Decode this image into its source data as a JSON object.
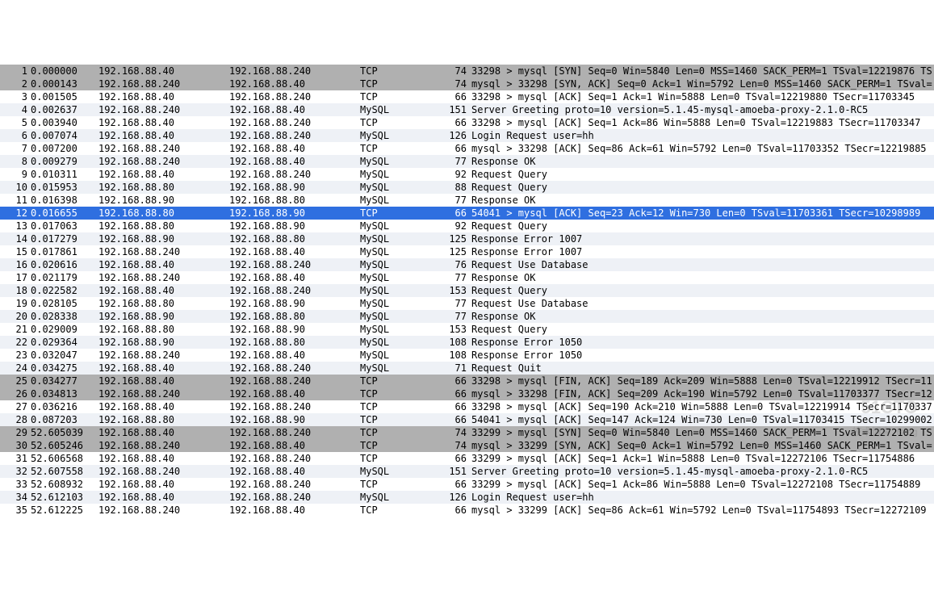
{
  "packets": [
    {
      "no": 1,
      "time": "0.000000",
      "src": "192.168.88.40",
      "dst": "192.168.88.240",
      "proto": "TCP",
      "len": 74,
      "info": "33298 > mysql [SYN] Seq=0 Win=5840 Len=0 MSS=1460 SACK_PERM=1 TSval=12219876 TS",
      "cls": "gray"
    },
    {
      "no": 2,
      "time": "0.000143",
      "src": "192.168.88.240",
      "dst": "192.168.88.40",
      "proto": "TCP",
      "len": 74,
      "info": "mysql > 33298 [SYN, ACK] Seq=0 Ack=1 Win=5792 Len=0 MSS=1460 SACK_PERM=1 TSval=",
      "cls": "gray"
    },
    {
      "no": 3,
      "time": "0.001505",
      "src": "192.168.88.40",
      "dst": "192.168.88.240",
      "proto": "TCP",
      "len": 66,
      "info": "33298 > mysql [ACK] Seq=1 Ack=1 Win=5888 Len=0 TSval=12219880 TSecr=11703345",
      "cls": "even"
    },
    {
      "no": 4,
      "time": "0.002637",
      "src": "192.168.88.240",
      "dst": "192.168.88.40",
      "proto": "MySQL",
      "len": 151,
      "info": "Server Greeting proto=10 version=5.1.45-mysql-amoeba-proxy-2.1.0-RC5",
      "cls": "odd"
    },
    {
      "no": 5,
      "time": "0.003940",
      "src": "192.168.88.40",
      "dst": "192.168.88.240",
      "proto": "TCP",
      "len": 66,
      "info": "33298 > mysql [ACK] Seq=1 Ack=86 Win=5888 Len=0 TSval=12219883 TSecr=11703347",
      "cls": "even"
    },
    {
      "no": 6,
      "time": "0.007074",
      "src": "192.168.88.40",
      "dst": "192.168.88.240",
      "proto": "MySQL",
      "len": 126,
      "info": "Login Request user=hh",
      "cls": "odd"
    },
    {
      "no": 7,
      "time": "0.007200",
      "src": "192.168.88.240",
      "dst": "192.168.88.40",
      "proto": "TCP",
      "len": 66,
      "info": "mysql > 33298 [ACK] Seq=86 Ack=61 Win=5792 Len=0 TSval=11703352 TSecr=12219885",
      "cls": "even"
    },
    {
      "no": 8,
      "time": "0.009279",
      "src": "192.168.88.240",
      "dst": "192.168.88.40",
      "proto": "MySQL",
      "len": 77,
      "info": "Response OK",
      "cls": "odd"
    },
    {
      "no": 9,
      "time": "0.010311",
      "src": "192.168.88.40",
      "dst": "192.168.88.240",
      "proto": "MySQL",
      "len": 92,
      "info": "Request Query",
      "cls": "even"
    },
    {
      "no": 10,
      "time": "0.015953",
      "src": "192.168.88.80",
      "dst": "192.168.88.90",
      "proto": "MySQL",
      "len": 88,
      "info": "Request Query",
      "cls": "odd"
    },
    {
      "no": 11,
      "time": "0.016398",
      "src": "192.168.88.90",
      "dst": "192.168.88.80",
      "proto": "MySQL",
      "len": 77,
      "info": "Response OK",
      "cls": "even"
    },
    {
      "no": 12,
      "time": "0.016655",
      "src": "192.168.88.80",
      "dst": "192.168.88.90",
      "proto": "TCP",
      "len": 66,
      "info": "54041 > mysql [ACK] Seq=23 Ack=12 Win=730 Len=0 TSval=11703361 TSecr=10298989",
      "cls": "sel"
    },
    {
      "no": 13,
      "time": "0.017063",
      "src": "192.168.88.80",
      "dst": "192.168.88.90",
      "proto": "MySQL",
      "len": 92,
      "info": "Request Query",
      "cls": "even"
    },
    {
      "no": 14,
      "time": "0.017279",
      "src": "192.168.88.90",
      "dst": "192.168.88.80",
      "proto": "MySQL",
      "len": 125,
      "info": "Response Error 1007",
      "cls": "odd"
    },
    {
      "no": 15,
      "time": "0.017861",
      "src": "192.168.88.240",
      "dst": "192.168.88.40",
      "proto": "MySQL",
      "len": 125,
      "info": "Response Error 1007",
      "cls": "even"
    },
    {
      "no": 16,
      "time": "0.020616",
      "src": "192.168.88.40",
      "dst": "192.168.88.240",
      "proto": "MySQL",
      "len": 76,
      "info": "Request Use Database",
      "cls": "odd"
    },
    {
      "no": 17,
      "time": "0.021179",
      "src": "192.168.88.240",
      "dst": "192.168.88.40",
      "proto": "MySQL",
      "len": 77,
      "info": "Response OK",
      "cls": "even"
    },
    {
      "no": 18,
      "time": "0.022582",
      "src": "192.168.88.40",
      "dst": "192.168.88.240",
      "proto": "MySQL",
      "len": 153,
      "info": "Request Query",
      "cls": "odd"
    },
    {
      "no": 19,
      "time": "0.028105",
      "src": "192.168.88.80",
      "dst": "192.168.88.90",
      "proto": "MySQL",
      "len": 77,
      "info": "Request Use Database",
      "cls": "even"
    },
    {
      "no": 20,
      "time": "0.028338",
      "src": "192.168.88.90",
      "dst": "192.168.88.80",
      "proto": "MySQL",
      "len": 77,
      "info": "Response OK",
      "cls": "odd"
    },
    {
      "no": 21,
      "time": "0.029009",
      "src": "192.168.88.80",
      "dst": "192.168.88.90",
      "proto": "MySQL",
      "len": 153,
      "info": "Request Query",
      "cls": "even"
    },
    {
      "no": 22,
      "time": "0.029364",
      "src": "192.168.88.90",
      "dst": "192.168.88.80",
      "proto": "MySQL",
      "len": 108,
      "info": "Response Error 1050",
      "cls": "odd"
    },
    {
      "no": 23,
      "time": "0.032047",
      "src": "192.168.88.240",
      "dst": "192.168.88.40",
      "proto": "MySQL",
      "len": 108,
      "info": "Response Error 1050",
      "cls": "even"
    },
    {
      "no": 24,
      "time": "0.034275",
      "src": "192.168.88.40",
      "dst": "192.168.88.240",
      "proto": "MySQL",
      "len": 71,
      "info": "Request Quit",
      "cls": "odd"
    },
    {
      "no": 25,
      "time": "0.034277",
      "src": "192.168.88.40",
      "dst": "192.168.88.240",
      "proto": "TCP",
      "len": 66,
      "info": "33298 > mysql [FIN, ACK] Seq=189 Ack=209 Win=5888 Len=0 TSval=12219912 TSecr=11",
      "cls": "gray"
    },
    {
      "no": 26,
      "time": "0.034813",
      "src": "192.168.88.240",
      "dst": "192.168.88.40",
      "proto": "TCP",
      "len": 66,
      "info": "mysql > 33298 [FIN, ACK] Seq=209 Ack=190 Win=5792 Len=0 TSval=11703377 TSecr=12",
      "cls": "gray"
    },
    {
      "no": 27,
      "time": "0.036216",
      "src": "192.168.88.40",
      "dst": "192.168.88.240",
      "proto": "TCP",
      "len": 66,
      "info": "33298 > mysql [ACK] Seq=190 Ack=210 Win=5888 Len=0 TSval=12219914 TSecr=1170337",
      "cls": "even"
    },
    {
      "no": 28,
      "time": "0.087203",
      "src": "192.168.88.80",
      "dst": "192.168.88.90",
      "proto": "TCP",
      "len": 66,
      "info": "54041 > mysql [ACK] Seq=147 Ack=124 Win=730 Len=0 TSval=11703415 TSecr=10299002",
      "cls": "odd"
    },
    {
      "no": 29,
      "time": "52.605039",
      "src": "192.168.88.40",
      "dst": "192.168.88.240",
      "proto": "TCP",
      "len": 74,
      "info": "33299 > mysql [SYN] Seq=0 Win=5840 Len=0 MSS=1460 SACK_PERM=1 TSval=12272102 TS",
      "cls": "gray"
    },
    {
      "no": 30,
      "time": "52.605246",
      "src": "192.168.88.240",
      "dst": "192.168.88.40",
      "proto": "TCP",
      "len": 74,
      "info": "mysql > 33299 [SYN, ACK] Seq=0 Ack=1 Win=5792 Len=0 MSS=1460 SACK_PERM=1 TSval=",
      "cls": "gray"
    },
    {
      "no": 31,
      "time": "52.606568",
      "src": "192.168.88.40",
      "dst": "192.168.88.240",
      "proto": "TCP",
      "len": 66,
      "info": "33299 > mysql [ACK] Seq=1 Ack=1 Win=5888 Len=0 TSval=12272106 TSecr=11754886",
      "cls": "even"
    },
    {
      "no": 32,
      "time": "52.607558",
      "src": "192.168.88.240",
      "dst": "192.168.88.40",
      "proto": "MySQL",
      "len": 151,
      "info": "Server Greeting proto=10 version=5.1.45-mysql-amoeba-proxy-2.1.0-RC5",
      "cls": "odd"
    },
    {
      "no": 33,
      "time": "52.608932",
      "src": "192.168.88.40",
      "dst": "192.168.88.240",
      "proto": "TCP",
      "len": 66,
      "info": "33299 > mysql [ACK] Seq=1 Ack=86 Win=5888 Len=0 TSval=12272108 TSecr=11754889",
      "cls": "even"
    },
    {
      "no": 34,
      "time": "52.612103",
      "src": "192.168.88.40",
      "dst": "192.168.88.240",
      "proto": "MySQL",
      "len": 126,
      "info": "Login Request user=hh",
      "cls": "odd"
    },
    {
      "no": 35,
      "time": "52.612225",
      "src": "192.168.88.240",
      "dst": "192.168.88.40",
      "proto": "TCP",
      "len": 66,
      "info": "mysql > 33299 [ACK] Seq=86 Ack=61 Win=5792 Len=0 TSval=11754893 TSecr=12272109",
      "cls": "even"
    }
  ],
  "watermark": {
    "line1": "51CTO",
    "line2": "技术博客  Blog"
  }
}
